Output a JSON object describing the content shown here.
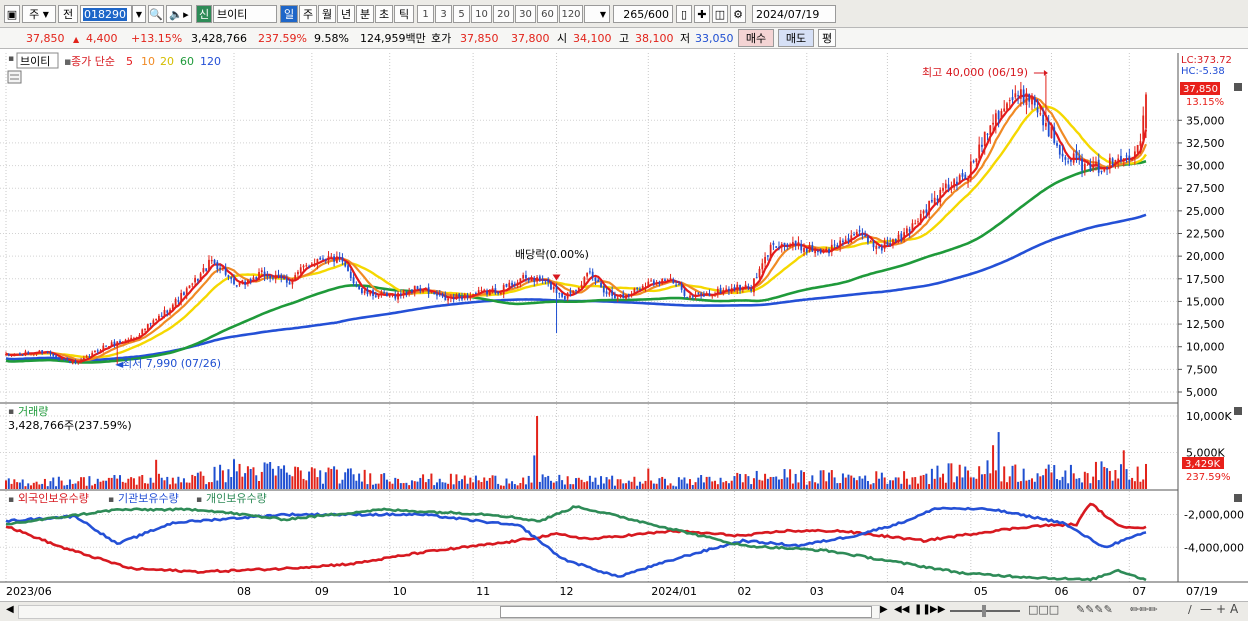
{
  "toolbar": {
    "market": "주",
    "type": "전",
    "code": "018290",
    "badge": "신",
    "name": "브이티",
    "periods": [
      "일",
      "주",
      "월",
      "년",
      "분",
      "초",
      "틱"
    ],
    "intervals": [
      "1",
      "3",
      "5",
      "10",
      "20",
      "30",
      "60",
      "120"
    ],
    "count": "265",
    "count_max": "/600",
    "date": "2024/07/19"
  },
  "quote": {
    "price": "37,850",
    "change": "4,400",
    "change_pct": "+13.15%",
    "volume": "3,428,766",
    "volume_ratio": "237.59%",
    "turnover": "9.58%",
    "trade_amount": "124,959백만",
    "ask_label": "호가",
    "ask": "37,850",
    "bid": "37,800",
    "open_label": "시",
    "open": "34,100",
    "high_label": "고",
    "high": "38,100",
    "low_label": "저",
    "low": "33,050",
    "buy_btn": "매수",
    "sell_btn": "매도",
    "eval_btn": "평"
  },
  "price_panel": {
    "name": "브이티",
    "legend_label": "종가 단순",
    "ma": [
      {
        "period": "5",
        "color": "#e41a1c"
      },
      {
        "period": "10",
        "color": "#f08a24"
      },
      {
        "period": "20",
        "color": "#f5d800"
      },
      {
        "period": "60",
        "color": "#1f9a3a"
      },
      {
        "period": "120",
        "color": "#2450d6"
      }
    ],
    "lc": "LC:373.72",
    "hc": "HC:-5.38",
    "last_price": "37,850",
    "last_pct": "13.15%",
    "max_label": "최고 40,000 (06/19)",
    "min_label": "최저 7,990 (07/26)",
    "dividend_label": "배당락(0.00%)"
  },
  "volume_panel": {
    "title": "거래량",
    "info": "3,428,766주(237.59%)",
    "last": "3,429K",
    "last_pct": "237.59%"
  },
  "holding_panel": {
    "series": [
      {
        "name": "외국인보유수량",
        "color": "#d71920"
      },
      {
        "name": "기관보유수량",
        "color": "#2450d6"
      },
      {
        "name": "개인보유수량",
        "color": "#2e8b57"
      }
    ]
  },
  "chart_data": {
    "type": "candlestick",
    "x_ticks": [
      "2023/06",
      "08",
      "09",
      "10",
      "11",
      "12",
      "2024/01",
      "02",
      "03",
      "04",
      "05",
      "06",
      "07",
      "07/19"
    ],
    "price_axis": [
      "35,000",
      "32,500",
      "30,000",
      "27,500",
      "25,000",
      "22,500",
      "20,000",
      "17,500",
      "15,000",
      "12,500",
      "10,000",
      "7,500",
      "5,000"
    ],
    "price_ylim": [
      5000,
      40000
    ],
    "volume_axis": [
      "10,000K",
      "5,000K"
    ],
    "volume_ylim": [
      0,
      10000
    ],
    "holding_axis": [
      "-2,000,000",
      "-4,000,000"
    ],
    "holding_ylim": [
      -6000000,
      -1000000
    ],
    "close_anchors": [
      [
        0,
        9000
      ],
      [
        14,
        9500
      ],
      [
        22,
        8400
      ],
      [
        26,
        8200
      ],
      [
        35,
        10000
      ],
      [
        46,
        11000
      ],
      [
        56,
        13500
      ],
      [
        66,
        16500
      ],
      [
        74,
        19500
      ],
      [
        79,
        18200
      ],
      [
        82,
        16500
      ],
      [
        92,
        18000
      ],
      [
        102,
        17200
      ],
      [
        108,
        19000
      ],
      [
        114,
        20000
      ],
      [
        120,
        19500
      ],
      [
        128,
        16000
      ],
      [
        138,
        15500
      ],
      [
        148,
        16500
      ],
      [
        158,
        15200
      ],
      [
        168,
        15800
      ],
      [
        178,
        16300
      ],
      [
        185,
        17500
      ],
      [
        193,
        17300
      ],
      [
        201,
        15500
      ],
      [
        210,
        18000
      ],
      [
        216,
        16000
      ],
      [
        222,
        15500
      ],
      [
        230,
        17000
      ],
      [
        238,
        17500
      ],
      [
        246,
        15500
      ],
      [
        253,
        15800
      ],
      [
        261,
        16500
      ],
      [
        268,
        16500
      ],
      [
        276,
        21500
      ],
      [
        286,
        21000
      ],
      [
        295,
        20500
      ],
      [
        305,
        22500
      ],
      [
        314,
        21000
      ],
      [
        322,
        22000
      ],
      [
        330,
        25000
      ],
      [
        338,
        27500
      ],
      [
        346,
        29000
      ],
      [
        354,
        35000
      ],
      [
        360,
        37000
      ],
      [
        368,
        38000
      ],
      [
        373,
        35000
      ],
      [
        380,
        31500
      ],
      [
        390,
        29500
      ],
      [
        400,
        30500
      ],
      [
        405,
        31500
      ],
      [
        408,
        33500
      ],
      [
        410,
        37850
      ]
    ],
    "volume_anchors": [
      [
        0,
        900
      ],
      [
        70,
        1500
      ],
      [
        82,
        2600
      ],
      [
        150,
        1300
      ],
      [
        200,
        1200
      ],
      [
        240,
        1000
      ],
      [
        276,
        1700
      ],
      [
        320,
        1500
      ],
      [
        350,
        2500
      ],
      [
        380,
        2000
      ],
      [
        410,
        2700
      ]
    ],
    "volume_spikes": [
      [
        54,
        4000
      ],
      [
        190,
        4600
      ],
      [
        191,
        10000
      ],
      [
        231,
        2800
      ],
      [
        355,
        6000
      ],
      [
        357,
        7800
      ],
      [
        402,
        5300
      ],
      [
        410,
        3429
      ]
    ],
    "holding_series": {
      "외국인보유수량": [
        [
          0,
          -2700000
        ],
        [
          20,
          -4000000
        ],
        [
          45,
          -5300000
        ],
        [
          70,
          -5500000
        ],
        [
          100,
          -5300000
        ],
        [
          125,
          -5000000
        ],
        [
          150,
          -4300000
        ],
        [
          180,
          -3700000
        ],
        [
          198,
          -3200000
        ],
        [
          210,
          -3500000
        ],
        [
          240,
          -3000000
        ],
        [
          265,
          -3300000
        ],
        [
          280,
          -3000000
        ],
        [
          300,
          -3000000
        ],
        [
          330,
          -3600000
        ],
        [
          355,
          -3000000
        ],
        [
          370,
          -2700000
        ],
        [
          385,
          -2600000
        ],
        [
          390,
          -1300000
        ],
        [
          400,
          -2700000
        ],
        [
          410,
          -2800000
        ]
      ],
      "기관보유수량": [
        [
          0,
          -2400000
        ],
        [
          25,
          -2100000
        ],
        [
          40,
          -3800000
        ],
        [
          60,
          -2500000
        ],
        [
          100,
          -2000000
        ],
        [
          150,
          -2000000
        ],
        [
          185,
          -2700000
        ],
        [
          200,
          -4700000
        ],
        [
          220,
          -5800000
        ],
        [
          245,
          -4500000
        ],
        [
          265,
          -3600000
        ],
        [
          285,
          -3900000
        ],
        [
          305,
          -3300000
        ],
        [
          322,
          -2500000
        ],
        [
          335,
          -1600000
        ],
        [
          355,
          -1700000
        ],
        [
          380,
          -2500000
        ],
        [
          395,
          -4000000
        ],
        [
          410,
          -3100000
        ]
      ],
      "개인보유수량": [
        [
          0,
          -2600000
        ],
        [
          40,
          -1700000
        ],
        [
          70,
          -1700000
        ],
        [
          100,
          -2300000
        ],
        [
          135,
          -1700000
        ],
        [
          175,
          -2000000
        ],
        [
          192,
          -2400000
        ],
        [
          205,
          -1500000
        ],
        [
          235,
          -2700000
        ],
        [
          265,
          -3900000
        ],
        [
          295,
          -4200000
        ],
        [
          320,
          -4900000
        ],
        [
          345,
          -5600000
        ],
        [
          365,
          -5800000
        ],
        [
          390,
          -6000000
        ],
        [
          400,
          -5400000
        ],
        [
          410,
          -6000000
        ]
      ]
    },
    "max_point": {
      "index": 374,
      "value": 40000
    },
    "min_point": {
      "index": 40,
      "value": 7990
    },
    "dividend_index": 198
  }
}
